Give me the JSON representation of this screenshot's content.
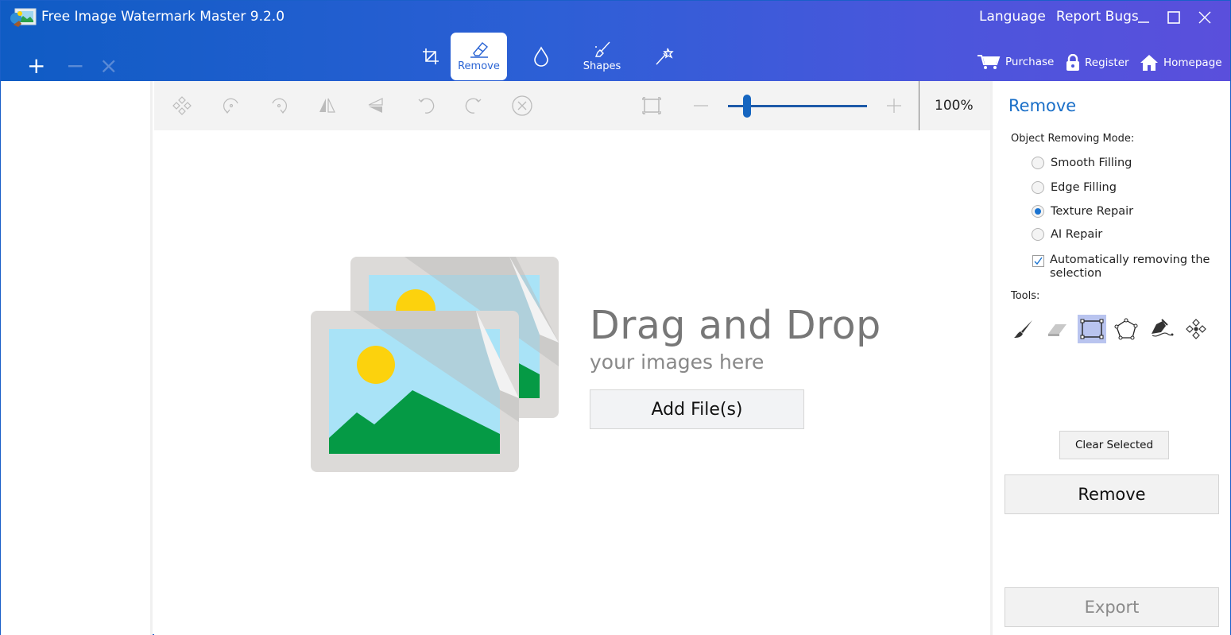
{
  "app": {
    "title": "Free Image Watermark Master 9.2.0",
    "top_links": [
      "Language",
      "Report Bugs"
    ],
    "window_controls": [
      "minimize",
      "maximize",
      "close"
    ]
  },
  "list_controls": {
    "add_label": "+",
    "remove_label": "−",
    "clear_label": "×"
  },
  "modes": [
    {
      "id": "crop",
      "label": "",
      "icon": "crop-icon",
      "active": false
    },
    {
      "id": "remove",
      "label": "Remove",
      "icon": "eraser-icon",
      "active": true
    },
    {
      "id": "watermark",
      "label": "",
      "icon": "drop-icon",
      "active": false
    },
    {
      "id": "shapes",
      "label": "Shapes",
      "icon": "brush-icon",
      "active": false
    },
    {
      "id": "magic",
      "label": "",
      "icon": "magic-wand-icon",
      "active": false
    }
  ],
  "header_actions": [
    {
      "label": "Purchase",
      "icon": "cart-icon"
    },
    {
      "label": "Register",
      "icon": "lock-icon"
    },
    {
      "label": "Homepage",
      "icon": "home-icon"
    }
  ],
  "toolbar": {
    "buttons": [
      "move-icon",
      "rotate-left-icon",
      "rotate-right-icon",
      "flip-horizontal-icon",
      "flip-vertical-icon",
      "undo-icon",
      "redo-icon",
      "cancel-icon"
    ],
    "fit_icon": "fit-screen-icon",
    "zoom_out_icon": "minus-icon",
    "zoom_in_icon": "plus-icon",
    "zoom_percent": 100,
    "zoom_label": "100%",
    "zoom_slider_fraction": 0.13
  },
  "canvas": {
    "title": "Drag and Drop",
    "subtitle": "your images here",
    "add_button": "Add File(s)"
  },
  "panel": {
    "title": "Remove",
    "mode_label": "Object Removing Mode:",
    "modes": [
      {
        "label": "Smooth Filling",
        "checked": false
      },
      {
        "label": "Edge Filling",
        "checked": false
      },
      {
        "label": "Texture Repair",
        "checked": true
      },
      {
        "label": "AI Repair",
        "checked": false
      }
    ],
    "auto_remove": {
      "label": "Automatically removing the selection",
      "checked": true
    },
    "tools_label": "Tools:",
    "tools": [
      {
        "name": "brush-icon",
        "active": false
      },
      {
        "name": "eraser-icon",
        "active": false
      },
      {
        "name": "rectangle-select-icon",
        "active": true
      },
      {
        "name": "polygon-select-icon",
        "active": false
      },
      {
        "name": "pen-icon",
        "active": false
      },
      {
        "name": "move-icon",
        "active": false
      }
    ],
    "clear_selected": "Clear Selected",
    "remove_button": "Remove",
    "export_button": "Export"
  },
  "colors": {
    "header_start": "#0f5cc4",
    "header_end": "#5a4fdc",
    "accent": "#1a6fc8",
    "tool_active_bg": "#b9c4ef"
  }
}
